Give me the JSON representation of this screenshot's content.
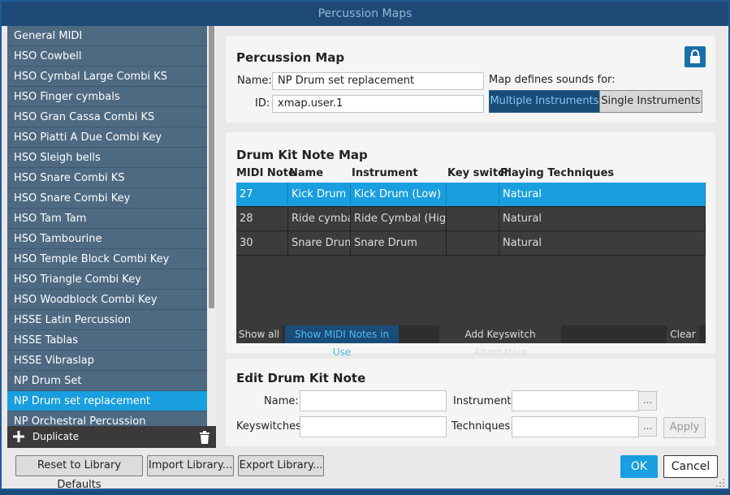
{
  "window": {
    "title": "Percussion Maps"
  },
  "map_list": {
    "items": [
      "General MIDI",
      "HSO Cowbell",
      "HSO Cymbal Large Combi KS",
      "HSO Finger cymbals",
      "HSO Gran Cassa Combi KS",
      "HSO Piatti A Due Combi Key",
      "HSO Sleigh bells",
      "HSO Snare Combi KS",
      "HSO Snare Combi Key",
      "HSO Tam Tam",
      "HSO Tambourine",
      "HSO Temple Block Combi Key",
      "HSO Triangle Combi Key",
      "HSO Woodblock Combi Key",
      "HSSE Latin Percussion",
      "HSSE Tablas",
      "HSSE Vibraslap",
      "NP Drum Set",
      "NP Drum set replacement",
      "NP Orchestral Percussion"
    ],
    "selected_index": 18,
    "duplicate_label": "Duplicate",
    "icons": {
      "add": "plus-icon",
      "delete": "trash-icon"
    }
  },
  "percussion_map": {
    "heading": "Percussion Map",
    "name_label": "Name:",
    "name_value": "NP Drum set replacement",
    "id_label": "ID:",
    "id_value": "xmap.user.1",
    "lock_icon": "lock-icon",
    "defines_label": "Map defines sounds for:",
    "multiple_label": "Multiple Instruments",
    "single_label": "Single Instruments",
    "active_mode": "Multiple Instruments"
  },
  "note_map": {
    "heading": "Drum Kit Note Map",
    "columns": [
      "MIDI Note",
      "Name",
      "Instrument",
      "Key switch",
      "Playing Techniques"
    ],
    "rows": [
      {
        "midi": "27",
        "name": "Kick Drum",
        "instrument": "Kick Drum (Low)",
        "keyswitch": "",
        "technique": "Natural"
      },
      {
        "midi": "28",
        "name": "Ride cymbal",
        "instrument": "Ride Cymbal (High)",
        "keyswitch": "",
        "technique": "Natural"
      },
      {
        "midi": "30",
        "name": "Snare Drum",
        "instrument": "Snare Drum",
        "keyswitch": "",
        "technique": "Natural"
      }
    ],
    "selected_row": 0,
    "show_all": "Show all",
    "show_in_use": "Show MIDI Notes in Use",
    "add_keyswitch": "Add Keyswitch Alternative",
    "clear": "Clear"
  },
  "edit_note": {
    "heading": "Edit Drum Kit Note",
    "name_label": "Name:",
    "name_value": "",
    "instrument_label": "Instrument:",
    "instrument_value": "",
    "keyswitches_label": "Keyswitches:",
    "keyswitches_value": "",
    "techniques_label": "Techniques:",
    "techniques_value": "",
    "ellipsis": "...",
    "apply": "Apply"
  },
  "footer": {
    "reset": "Reset to Library Defaults",
    "import": "Import Library...",
    "export": "Export Library...",
    "ok": "OK",
    "cancel": "Cancel"
  },
  "colors": {
    "accent": "#199ee0",
    "title_bar": "#1f4a78",
    "list_bg": "#4e6a82"
  }
}
